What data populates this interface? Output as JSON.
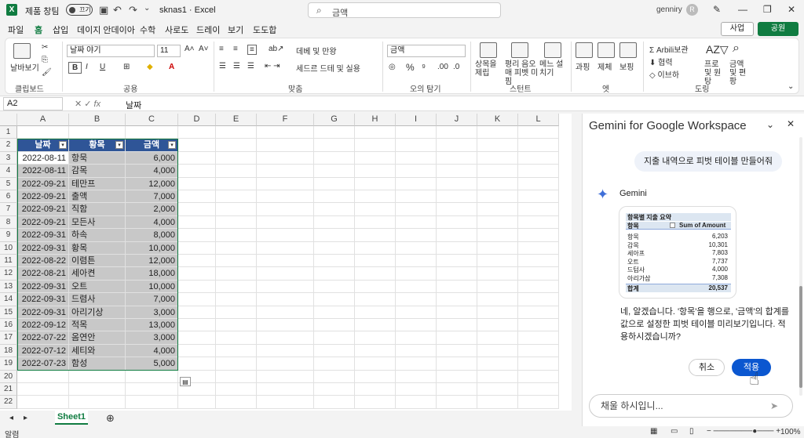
{
  "titlebar": {
    "autosave_label": "제품 창팀",
    "toggle_label": "끄기",
    "filename": "sknas1 · Excel",
    "search_placeholder": "금액",
    "user": "genniry"
  },
  "tabs": [
    "파일",
    "홈",
    "삽입",
    "데이지 안데이아",
    "수학",
    "사로도",
    "드레이",
    "보기",
    "도도합"
  ],
  "active_tab": "홈",
  "share_buttons": {
    "comment": "사업",
    "share": "공원"
  },
  "ribbon": {
    "paste": "날바보기",
    "clipboard_label": "클립보드",
    "font_name": "날짜 야기",
    "font_size": "11",
    "font_label": "공용",
    "align_label": "맞춤",
    "wrap": "데베 및 만왕",
    "merge": "세드르 드테 및 실용",
    "number_format": "금액",
    "number_label": "오의 탐기",
    "cond_format": "상목을 제립",
    "table_format": "평리 음오매 피벳 미핌",
    "cell_styles": "메느 설치기",
    "styles_label": "스턴트",
    "insert": "과핑",
    "delete": "제체",
    "format": "보핑",
    "cells_label": "엣",
    "autosum": "Arbili보관",
    "fill": "협력",
    "clear": "이브하",
    "sort": "프로 및 원탕",
    "find": "금액 및 편팡",
    "editing_label": "도링"
  },
  "formula_bar": {
    "cell_ref": "A2",
    "value": "날짜"
  },
  "columns": [
    "A",
    "B",
    "C",
    "D",
    "E",
    "F",
    "G",
    "H",
    "I",
    "J",
    "K",
    "L"
  ],
  "table": {
    "headers": [
      "날짜",
      "황목",
      "금액"
    ],
    "rows": [
      [
        "2022-08-11",
        "항묵",
        "6,000"
      ],
      [
        "2022-08-11",
        "감목",
        "4,000"
      ],
      [
        "2022-09-21",
        "테만프",
        "12,000"
      ],
      [
        "2022-09-21",
        "출액",
        "7,000"
      ],
      [
        "2022-09-21",
        "직함",
        "2,000"
      ],
      [
        "2022-09-21",
        "모든사",
        "4,000"
      ],
      [
        "2022-09-31",
        "하속",
        "8,000"
      ],
      [
        "2022-09-31",
        "황목",
        "10,000"
      ],
      [
        "2022-08-22",
        "이렴튼",
        "12,000"
      ],
      [
        "2022-08-21",
        "세아켠",
        "18,000"
      ],
      [
        "2022-09-31",
        "오트",
        "10,000"
      ],
      [
        "2022-09-31",
        "드렴사",
        "7,000"
      ],
      [
        "2022-09-31",
        "아리기상",
        "3,000"
      ],
      [
        "2022-09-12",
        "적목",
        "13,000"
      ],
      [
        "2022-07-22",
        "옴연안",
        "3,000"
      ],
      [
        "2022-07-12",
        "세티와",
        "4,000"
      ],
      [
        "2022-07-23",
        "함성",
        "5,000"
      ]
    ]
  },
  "row_numbers": [
    "1",
    "2",
    "3",
    "4",
    "5",
    "6",
    "7",
    "8",
    "9",
    "10",
    "11",
    "12",
    "13",
    "14",
    "15",
    "16",
    "17",
    "18",
    "19",
    "20",
    "21",
    "22"
  ],
  "sheet_tab": "Sheet1",
  "status": {
    "left": "알렴",
    "zoom": "100%"
  },
  "gemini": {
    "title": "Gemini for Google Workspace",
    "user_message": "지출 내역으로 피벗 테이블 만들어줘",
    "name": "Gemini",
    "pivot": {
      "title": "항목별 지출 요약",
      "col1": "항목",
      "col2": "Sum of Amount",
      "rows": [
        [
          "항목",
          "6,203"
        ],
        [
          "감목",
          "10,301"
        ],
        [
          "세아프",
          "7,803"
        ],
        [
          "오트",
          "7,737"
        ],
        [
          "드텀사",
          "4,000"
        ],
        [
          "아리가삼",
          "7,308"
        ]
      ],
      "total_label": "합계",
      "total_value": "20,537"
    },
    "answer": "네, 알겠습니다. '항목'을 행으로, '금액'의 합계를 값으로 설정한 피벗 테이블 미리보기입니다. 적용하시겠습니까?",
    "cancel": "취소",
    "apply": "적용",
    "input_placeholder": "채울 하시입니..."
  }
}
